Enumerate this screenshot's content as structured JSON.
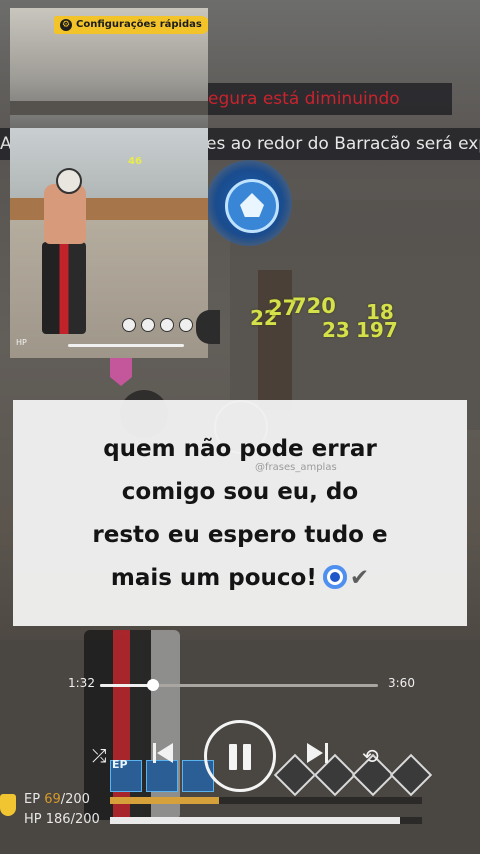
{
  "game": {
    "notices": {
      "zone_warning": "egura está diminuindo",
      "zone_info": "es ao redor do Barracão será expo",
      "left_fragment": "A"
    },
    "damage_numbers": [
      "22",
      "27",
      "720",
      "18",
      "23",
      "197"
    ]
  },
  "pip": {
    "badge_label": "Configurações rápidas",
    "counter": "46",
    "hp_label": "HP"
  },
  "caption": {
    "lines": [
      "quem não pode errar",
      "comigo sou eu, do",
      "resto eu espero tudo e",
      "mais um pouco!"
    ],
    "emoji_check": "✔",
    "watermark": "@frases_amplas"
  },
  "player": {
    "elapsed": "1:32",
    "total": "3:60",
    "progress_fraction": 0.19,
    "controls": {
      "shuffle_glyph": "⤮",
      "repeat_glyph": "⟲"
    }
  },
  "stats": {
    "ep_label": "EP",
    "ep_current": "69",
    "ep_max": "200",
    "ep_fraction": 0.35,
    "hp_label": "HP",
    "hp_current": "186",
    "hp_max": "200",
    "hp_fraction": 0.93,
    "skill_label": "EP"
  },
  "colors": {
    "zone_warning": "#c8242d",
    "damage": "#d5e14a",
    "ep_bar": "#d6a13b",
    "badge": "#f3c32a"
  }
}
